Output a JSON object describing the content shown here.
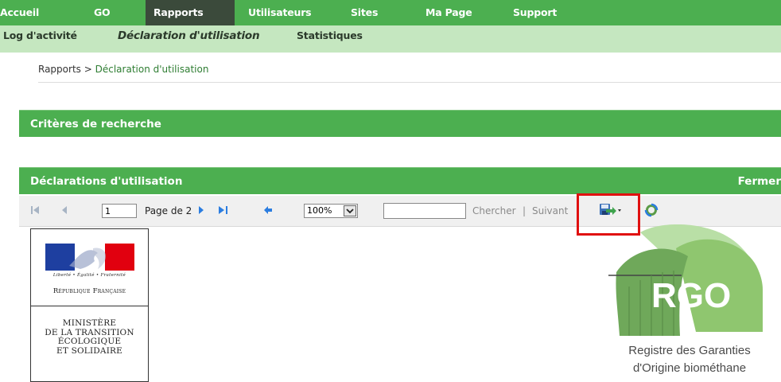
{
  "topnav": {
    "items": [
      {
        "label": "Accueil"
      },
      {
        "label": "GO"
      },
      {
        "label": "Rapports"
      },
      {
        "label": "Utilisateurs"
      },
      {
        "label": "Sites"
      },
      {
        "label": "Ma Page"
      },
      {
        "label": "Support"
      }
    ],
    "active": "Rapports"
  },
  "subnav": {
    "items": [
      {
        "label": "Log d'activité"
      },
      {
        "label": "Déclaration d'utilisation"
      },
      {
        "label": "Statistiques"
      }
    ],
    "active": "Déclaration d'utilisation"
  },
  "breadcrumb": {
    "root": "Rapports",
    "separator": ">",
    "current": "Déclaration d'utilisation"
  },
  "panels": {
    "search_criteria": {
      "title": "Critères de recherche"
    },
    "declarations": {
      "title": "Déclarations d'utilisation",
      "close_label": "Fermer"
    }
  },
  "report_toolbar": {
    "page_input_value": "1",
    "page_of_label": "Page de 2",
    "zoom_value": "100%",
    "search_value": "",
    "find_label": "Chercher",
    "separator": "|",
    "next_label": "Suivant",
    "icons": [
      "first-page-icon",
      "previous-page-icon",
      "next-page-icon",
      "last-page-icon",
      "back-icon",
      "export-save-icon",
      "refresh-icon"
    ]
  },
  "report": {
    "republique_motto": "Liberté • Égalité • Fraternité",
    "republique_label": "République Française",
    "ministere_lines": [
      "MINISTÈRE",
      "DE LA TRANSITION",
      "ÉCOLOGIQUE",
      "ET SOLIDAIRE"
    ],
    "rgo_logo_text": "RGO",
    "rgo_caption_line1": "Registre des Garanties",
    "rgo_caption_line2": "d'Origine biométhane"
  },
  "colors": {
    "primary_green": "#4caf50",
    "active_nav": "#3b4a3b",
    "subnav_bg": "#c5e7c0",
    "highlight_red": "#e01010",
    "rgo_green": "#8fc66f"
  }
}
